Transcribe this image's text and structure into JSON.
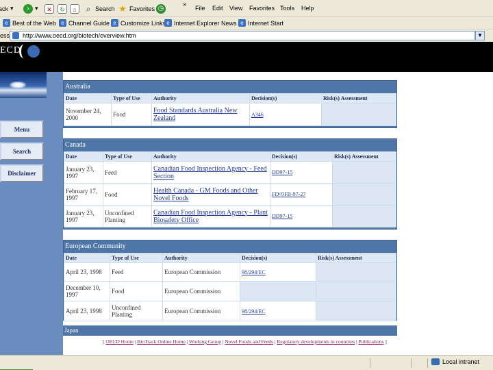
{
  "toolbar": {
    "back_label": "Back",
    "search_label": "Search",
    "favorites_label": "Favorites",
    "chevron": "»",
    "menu": [
      "File",
      "Edit",
      "View",
      "Favorites",
      "Tools",
      "Help"
    ]
  },
  "links": {
    "items": [
      "Best of the Web",
      "Channel Guide",
      "Customize Links",
      "Internet Explorer News",
      "Internet Start"
    ]
  },
  "address": {
    "label": "ess",
    "url": "http://www.oecd.org/biotech/overview.htm"
  },
  "banner": {
    "logo_text": "ECD"
  },
  "nav": {
    "menu_label": "Menu",
    "search_label": "Search",
    "disclaimer_label": "Disclaimer"
  },
  "sections": {
    "australia": {
      "title": "Australia",
      "headers": [
        "Date",
        "Type of Use",
        "Authority",
        "Decision(s)",
        "Risk(s) Assessment"
      ],
      "rows": [
        [
          "November 24, 2000",
          "Food",
          "Food Standards Australia New Zealand",
          "A346",
          ""
        ]
      ]
    },
    "canada": {
      "title": "Canada",
      "headers": [
        "Date",
        "Type of Use",
        "Authority",
        "Decision(s)",
        "Risk(s) Assessment"
      ],
      "rows": [
        [
          "January 23, 1997",
          "Feed",
          "Canadian Food Inspection Agency - Feed Section",
          "DD97-15",
          ""
        ],
        [
          "February 17, 1997",
          "Food",
          "Health Canada - GM Foods and Other Novel Foods",
          "FD/OFB-97-27",
          ""
        ],
        [
          "January 23, 1997",
          "Unconfined Planting",
          "Canadian Food Inspection Agency - Plant Biosafety Office",
          "DD97-15",
          ""
        ]
      ]
    },
    "eu": {
      "title": "European Community",
      "headers": [
        "Date",
        "Type of Use",
        "Authority",
        "Decision(s)",
        "Risk(s) Assessment"
      ],
      "rows": [
        [
          "April 23, 1998",
          "Feed",
          "European Commission",
          "98/294/EC",
          ""
        ],
        [
          "December 10, 1997",
          "Food",
          "European Commission",
          "",
          ""
        ],
        [
          "April 23, 1998",
          "Unconfined Planting",
          "European Commission",
          "98/294/EC",
          ""
        ]
      ]
    },
    "japan": {
      "title": "Japan"
    }
  },
  "footer": {
    "links": [
      "OECD Home",
      "BioTrack Online Home",
      "Working Group",
      "Novel Foods and Feeds",
      "Regulatory developments in countries",
      "Publications"
    ]
  },
  "status": {
    "zone": "Local intranet"
  }
}
